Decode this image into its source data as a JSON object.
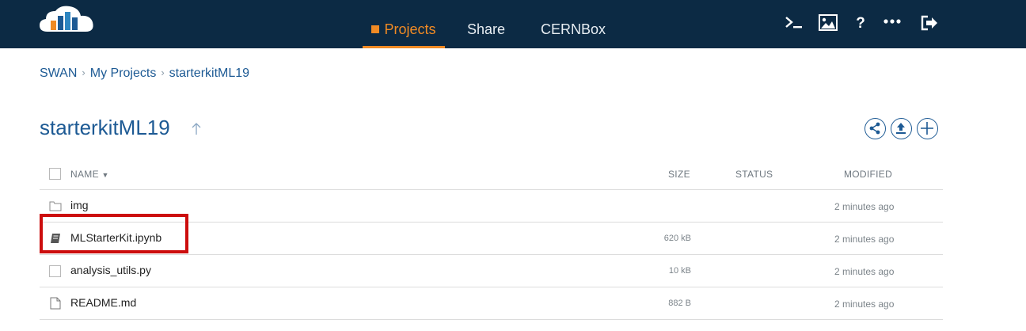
{
  "nav": {
    "tabs": [
      {
        "label": "Projects",
        "icon": "projects-icon",
        "active": true
      },
      {
        "label": "Share",
        "active": false
      },
      {
        "label": "CERNBox",
        "active": false
      }
    ],
    "toolbar_icons": [
      "terminal-icon",
      "image-icon",
      "help-icon",
      "more-icon",
      "logout-icon"
    ],
    "accent_color": "#f08a24",
    "bar_color": "#0c2a44"
  },
  "breadcrumb": [
    "SWAN",
    "My Projects",
    "starterkitML19"
  ],
  "project": {
    "title": "starterkitML19",
    "actions": [
      "share-icon",
      "upload-icon",
      "add-icon"
    ]
  },
  "table": {
    "headers": {
      "name": "NAME",
      "size": "SIZE",
      "status": "STATUS",
      "modified": "MODIFIED"
    },
    "rows": [
      {
        "name": "img",
        "type": "folder-icon",
        "size": "",
        "modified": "2 minutes ago"
      },
      {
        "name": "MLStarterKit.ipynb",
        "type": "notebook-icon",
        "size": "620 kB",
        "modified": "2 minutes ago",
        "highlighted": true
      },
      {
        "name": "analysis_utils.py",
        "type": "file-checkbox",
        "size": "10 kB",
        "modified": "2 minutes ago"
      },
      {
        "name": "README.md",
        "type": "file-icon",
        "size": "882 B",
        "modified": "2 minutes ago"
      }
    ]
  }
}
